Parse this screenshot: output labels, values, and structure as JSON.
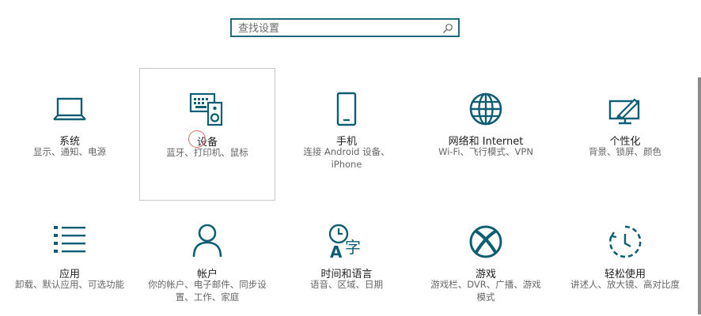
{
  "search": {
    "placeholder": "查找设置"
  },
  "tiles": [
    {
      "title": "系统",
      "desc": "显示、通知、电源",
      "icon": "laptop-icon"
    },
    {
      "title": "设备",
      "desc": "蓝牙、打印机、鼠标",
      "icon": "devices-icon"
    },
    {
      "title": "手机",
      "desc": "连接 Android 设备、iPhone",
      "icon": "phone-icon"
    },
    {
      "title": "网络和 Internet",
      "desc": "Wi-Fi、飞行模式、VPN",
      "icon": "globe-icon"
    },
    {
      "title": "个性化",
      "desc": "背景、锁屏、颜色",
      "icon": "personalization-icon"
    },
    {
      "title": "应用",
      "desc": "卸载、默认应用、可选功能",
      "icon": "apps-list-icon"
    },
    {
      "title": "帐户",
      "desc": "你的帐户、电子邮件、同步设置、工作、家庭",
      "icon": "person-icon"
    },
    {
      "title": "时间和语言",
      "desc": "语音、区域、日期",
      "icon": "time-language-icon"
    },
    {
      "title": "游戏",
      "desc": "游戏栏、DVR、广播、游戏模式",
      "icon": "xbox-icon"
    },
    {
      "title": "轻松使用",
      "desc": "讲述人、放大镜、高对比度",
      "icon": "ease-of-access-icon"
    }
  ],
  "colors": {
    "accent": "#1e6a7d",
    "icon": "#0f5e74"
  }
}
